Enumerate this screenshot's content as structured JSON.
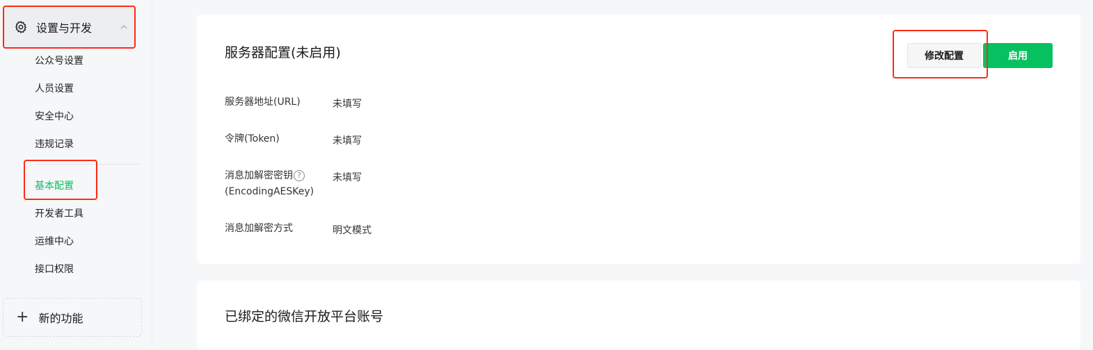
{
  "sidebar": {
    "group_label": "设置与开发",
    "items": [
      {
        "label": "公众号设置"
      },
      {
        "label": "人员设置"
      },
      {
        "label": "安全中心"
      },
      {
        "label": "违规记录"
      },
      {
        "label": "基本配置",
        "active": true
      },
      {
        "label": "开发者工具"
      },
      {
        "label": "运维中心"
      },
      {
        "label": "接口权限"
      }
    ],
    "new_feature_label": "新的功能"
  },
  "server_config": {
    "title": "服务器配置(未启用)",
    "edit_button": "修改配置",
    "enable_button": "启用",
    "fields": [
      {
        "label": "服务器地址(URL)",
        "value": "未填写"
      },
      {
        "label": "令牌(Token)",
        "value": "未填写"
      },
      {
        "label_line1": "消息加解密密钥",
        "label_line2": "(EncodingAESKey)",
        "help": "?",
        "value": "未填写"
      },
      {
        "label": "消息加解密方式",
        "value": "明文模式"
      }
    ]
  },
  "bound_accounts": {
    "title": "已绑定的微信开放平台账号"
  },
  "colors": {
    "accent": "#07c160",
    "annotation": "#ff2a16"
  }
}
